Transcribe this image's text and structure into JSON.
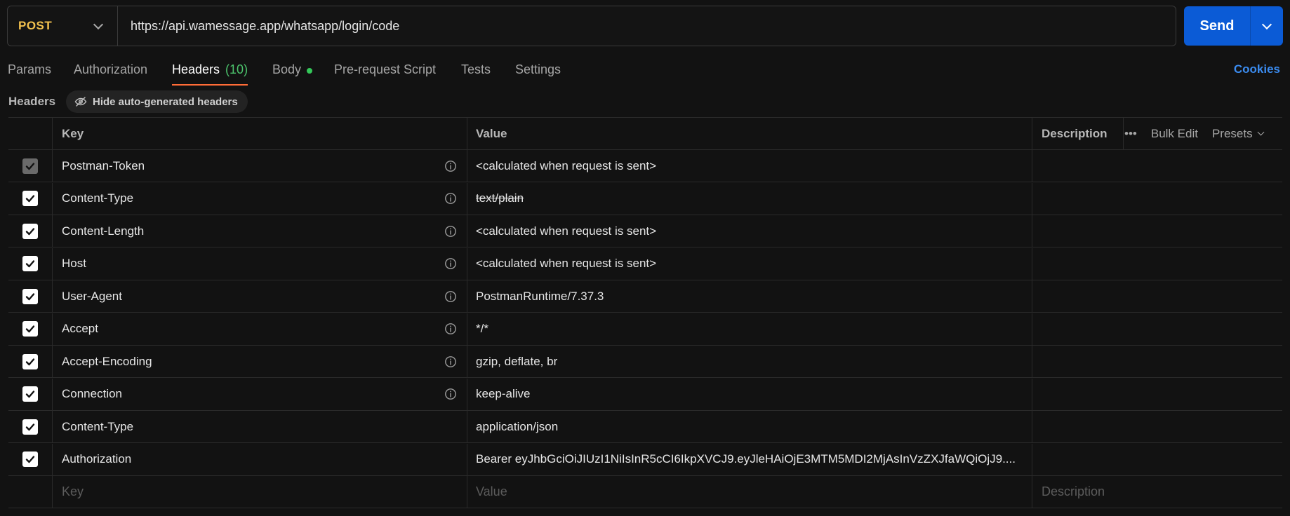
{
  "request": {
    "method": "POST",
    "url": "https://api.wamessage.app/whatsapp/login/code",
    "send_label": "Send"
  },
  "tabs": [
    {
      "label": "Params"
    },
    {
      "label": "Authorization"
    },
    {
      "label": "Headers",
      "count": "(10)",
      "active": true
    },
    {
      "label": "Body",
      "has_dot": true
    },
    {
      "label": "Pre-request Script"
    },
    {
      "label": "Tests"
    },
    {
      "label": "Settings"
    }
  ],
  "cookies_label": "Cookies",
  "headers_section": {
    "title": "Headers",
    "hide_button": "Hide auto-generated headers"
  },
  "table": {
    "columns": {
      "key": "Key",
      "value": "Value",
      "description": "Description"
    },
    "actions": {
      "more": "•••",
      "bulk_edit": "Bulk Edit",
      "presets": "Presets"
    },
    "rows": [
      {
        "key": "Postman-Token",
        "value": "<calculated when request is sent>",
        "checked": true,
        "disabled": true,
        "info": true
      },
      {
        "key": "Content-Type",
        "value": "text/plain",
        "checked": true,
        "info": true,
        "overridden": true
      },
      {
        "key": "Content-Length",
        "value": "<calculated when request is sent>",
        "checked": true,
        "info": true
      },
      {
        "key": "Host",
        "value": "<calculated when request is sent>",
        "checked": true,
        "info": true
      },
      {
        "key": "User-Agent",
        "value": "PostmanRuntime/7.37.3",
        "checked": true,
        "info": true
      },
      {
        "key": "Accept",
        "value": "*/*",
        "checked": true,
        "info": true
      },
      {
        "key": "Accept-Encoding",
        "value": "gzip, deflate, br",
        "checked": true,
        "info": true
      },
      {
        "key": "Connection",
        "value": "keep-alive",
        "checked": true,
        "info": true
      },
      {
        "key": "Content-Type",
        "value": "application/json",
        "checked": true,
        "info": false
      },
      {
        "key": "Authorization",
        "value": "Bearer eyJhbGciOiJIUzI1NiIsInR5cCI6IkpXVCJ9.eyJleHAiOjE3MTM5MDI2MjAsInVzZXJfaWQiOjJ9....",
        "checked": true,
        "info": false
      }
    ],
    "new_row": {
      "key_placeholder": "Key",
      "value_placeholder": "Value",
      "description_placeholder": "Description"
    }
  },
  "colors": {
    "accent": "#0b5bd6",
    "method": "#f2c14e",
    "tab_underline": "#ff6c37",
    "count": "#4cc36c",
    "link": "#3b8cf0"
  }
}
